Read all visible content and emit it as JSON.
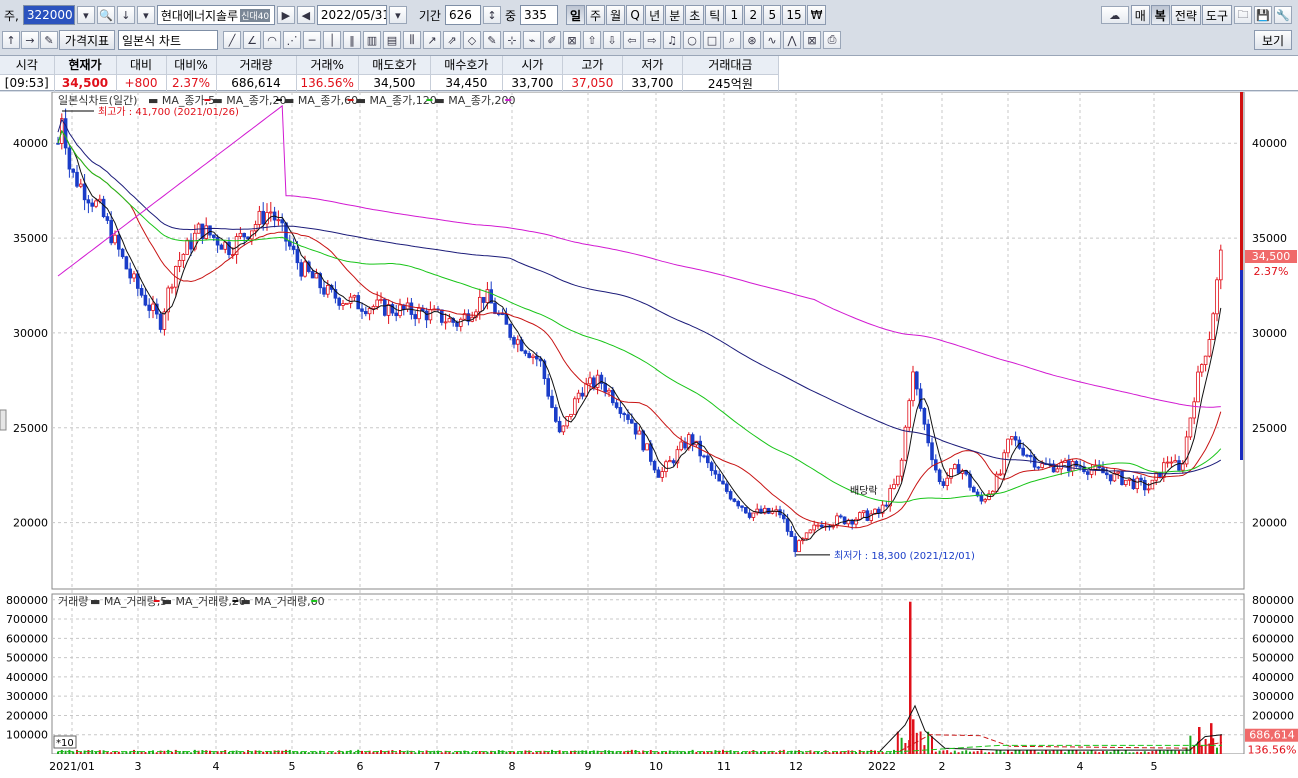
{
  "toolbar1": {
    "prefix": "주,",
    "code": "322000",
    "name": "현대에너지솔루",
    "name_badge": "신대40",
    "date": "2022/05/31",
    "period_label": "기간",
    "period_value": "626",
    "zoom_label": "중",
    "zoom_value": "335",
    "tabs": [
      "일",
      "주",
      "월",
      "Q",
      "년",
      "분",
      "초",
      "틱",
      "1",
      "2",
      "5",
      "15",
      "₩"
    ],
    "right_buttons": [
      "매",
      "복",
      "전략",
      "도구"
    ]
  },
  "toolbar2": {
    "indicator_button": "가격지표",
    "chart_type": "일본식 차트",
    "view_button": "보기"
  },
  "quote": {
    "headers": [
      "시각",
      "현재가",
      "대비",
      "대비%",
      "거래량",
      "거래%",
      "매도호가",
      "매수호가",
      "시가",
      "고가",
      "저가",
      "거래대금"
    ],
    "values": [
      "[09:53]",
      "34,500",
      "+800",
      "2.37%",
      "686,614",
      "136.56%",
      "34,500",
      "34,450",
      "33,700",
      "37,050",
      "33,700",
      "245억원"
    ]
  },
  "price_panel": {
    "legend_title": "일본식차트(일간)",
    "legend": [
      {
        "label": "MA_종가,5",
        "color": "#e0101a"
      },
      {
        "label": "MA_종가,20",
        "color": "#111111"
      },
      {
        "label": "MA_종가,60",
        "color": "#c81414"
      },
      {
        "label": "MA_종가,120",
        "color": "#19c519"
      },
      {
        "label": "MA_종가,200",
        "color": "#d21ad2"
      }
    ],
    "high_note": "최고가 : 41,700 (2021/01/26)",
    "low_note": "최저가 : 18,300 (2021/12/01)",
    "event_note": "배당락",
    "last_price": "34,500",
    "last_change": "2.37%",
    "y_ticks": [
      "40000",
      "35000",
      "30000",
      "25000",
      "20000"
    ]
  },
  "volume_panel": {
    "legend_title": "거래량",
    "legend": [
      {
        "label": "MA_거래량,5",
        "color": "#e0101a"
      },
      {
        "label": "MA_거래량,20",
        "color": "#111111"
      },
      {
        "label": "MA_거래량,60",
        "color": "#19c519"
      }
    ],
    "multiplier": "*10",
    "last_volume": "686,614",
    "last_ratio": "136.56%",
    "y_ticks": [
      "800000",
      "700000",
      "600000",
      "500000",
      "400000",
      "300000",
      "200000",
      "100000"
    ]
  },
  "x_axis": [
    "2021/01",
    "3",
    "4",
    "5",
    "6",
    "7",
    "8",
    "9",
    "10",
    "11",
    "12",
    "2022",
    "2",
    "3",
    "4",
    "5"
  ],
  "colors": {
    "up": "#e0101a",
    "down": "#1a3dc8",
    "grid": "#c8c8c8"
  },
  "chart_data": {
    "type": "candlestick",
    "price_series_approx": [
      {
        "x": "2021/01",
        "y": 40000
      },
      {
        "x": "2021/01/26",
        "y": 41700
      },
      {
        "x": "2021/02",
        "y": 35000
      },
      {
        "x": "2021/03",
        "y": 30500
      },
      {
        "x": "2021/04",
        "y": 35500
      },
      {
        "x": "2021/04/15",
        "y": 36500
      },
      {
        "x": "2021/05",
        "y": 33500
      },
      {
        "x": "2021/06",
        "y": 31500
      },
      {
        "x": "2021/07",
        "y": 30500
      },
      {
        "x": "2021/07/20",
        "y": 32000
      },
      {
        "x": "2021/08",
        "y": 28500
      },
      {
        "x": "2021/08/20",
        "y": 24500
      },
      {
        "x": "2021/09",
        "y": 27500
      },
      {
        "x": "2021/10",
        "y": 22000
      },
      {
        "x": "2021/10/15",
        "y": 24500
      },
      {
        "x": "2021/11",
        "y": 20500
      },
      {
        "x": "2021/12/01",
        "y": 18300
      },
      {
        "x": "2021/12",
        "y": 20000
      },
      {
        "x": "2022/01",
        "y": 20500
      },
      {
        "x": "2022/02/07",
        "y": 28000
      },
      {
        "x": "2022/02",
        "y": 21500
      },
      {
        "x": "2022/03",
        "y": 23500
      },
      {
        "x": "2022/04",
        "y": 23000
      },
      {
        "x": "2022/05",
        "y": 22500
      },
      {
        "x": "2022/05/20",
        "y": 30000
      },
      {
        "x": "2022/05/31",
        "y": 34500
      }
    ],
    "volume_spikes": [
      {
        "x": "2022/02",
        "y": 790000
      },
      {
        "x": "2022/05",
        "y": 686614
      }
    ]
  }
}
